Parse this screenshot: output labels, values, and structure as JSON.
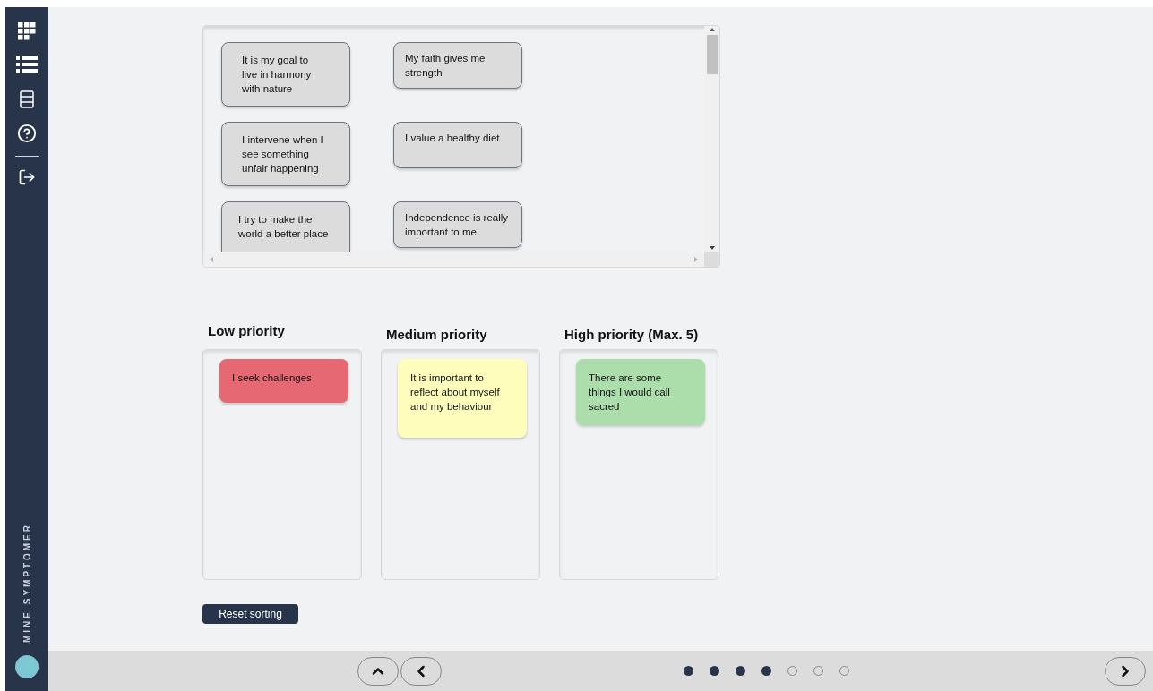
{
  "sidebar": {
    "items": [
      {
        "kind": "grid"
      },
      {
        "kind": "list"
      },
      {
        "kind": "cabinet"
      },
      {
        "kind": "help"
      },
      {
        "kind": "exit"
      }
    ],
    "brand": "MINE SYMPTOMER"
  },
  "pool": {
    "cards": [
      {
        "text": "It is my goal to live in harmony with nature"
      },
      {
        "text": "My faith gives me strength"
      },
      {
        "text": "I intervene when I see something unfair happening"
      },
      {
        "text": "I value a healthy diet"
      },
      {
        "text": "I try to make the world a better place"
      },
      {
        "text": "Independence is really important to me"
      }
    ]
  },
  "columns": [
    {
      "title": "Low priority",
      "color": "#e66872",
      "cards": [
        {
          "text": "I seek challenges"
        }
      ]
    },
    {
      "title": "Medium priority",
      "color": "#fefdbb",
      "cards": [
        {
          "text": "It is important to reflect about myself and my behaviour"
        }
      ]
    },
    {
      "title": "High priority (Max. 5)",
      "color": "#acdeab",
      "cards": [
        {
          "text": "There are some things I would call sacred"
        }
      ]
    }
  ],
  "reset_button": "Reset sorting",
  "footer": {
    "steps": [
      {
        "done": true
      },
      {
        "done": true
      },
      {
        "done": true
      },
      {
        "done": true
      },
      {
        "done": false
      },
      {
        "done": false
      },
      {
        "done": false
      }
    ]
  }
}
